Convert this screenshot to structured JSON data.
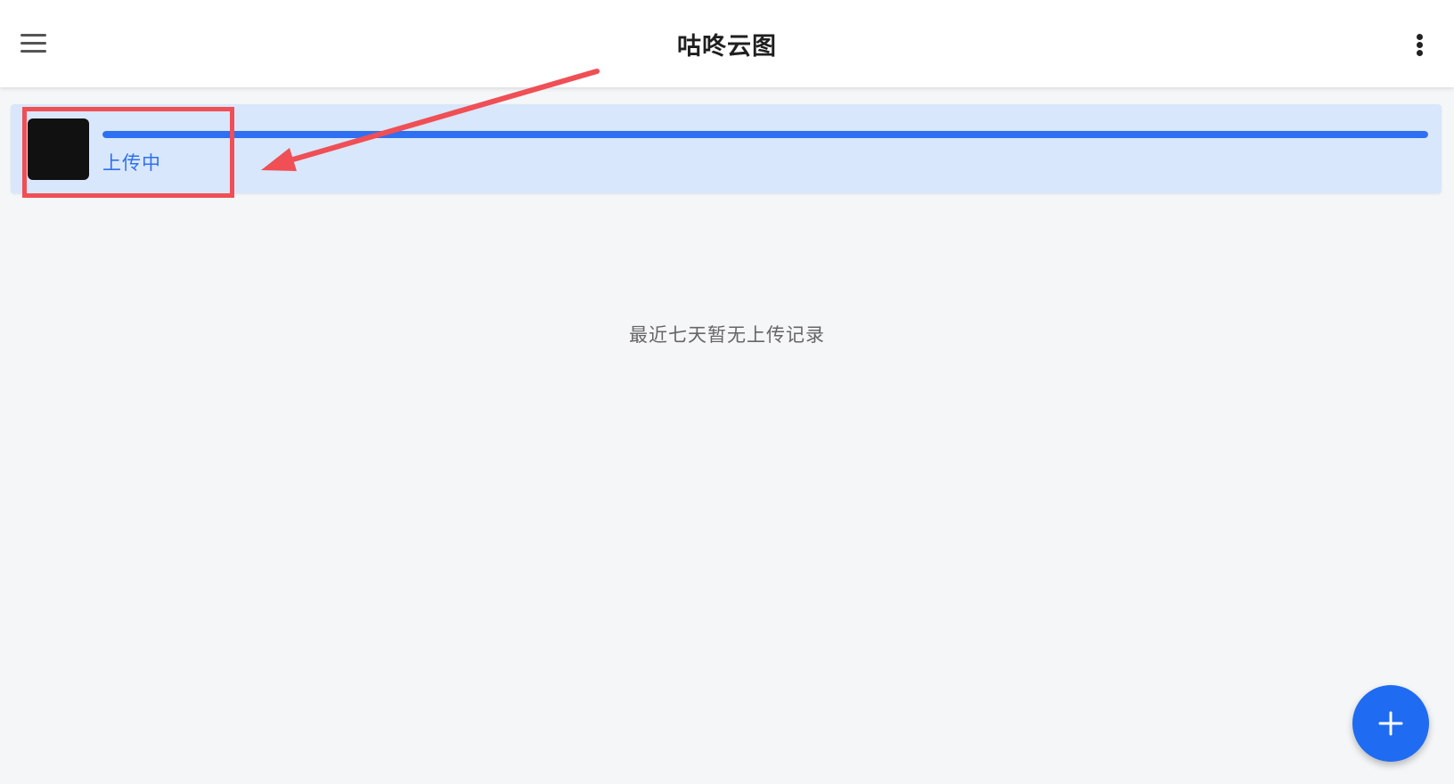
{
  "header": {
    "title": "咕咚云图",
    "menu_icon": "hamburger-menu-icon",
    "more_icon": "more-vertical-icon"
  },
  "upload_item": {
    "status": "上传中",
    "progress": 1.0,
    "thumbnail_color": "#111111"
  },
  "empty_state": {
    "message": "最近七天暂无上传记录"
  },
  "fab": {
    "icon": "plus-icon"
  },
  "colors": {
    "accent": "#2f6ff2",
    "card_background": "#d8e7fb",
    "annotation": "#ef4f55"
  }
}
